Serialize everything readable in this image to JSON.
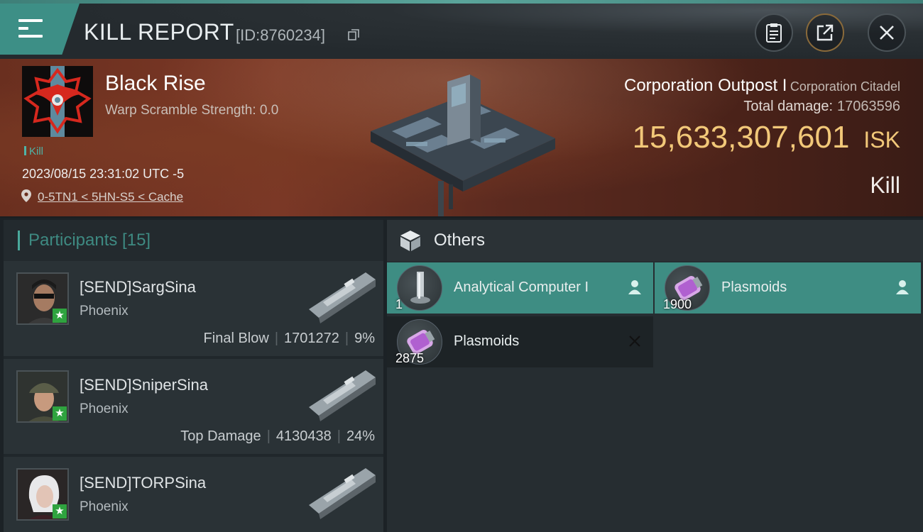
{
  "header": {
    "title": "KILL REPORT",
    "report_id": "[ID:8760234]",
    "icons": [
      "menu-icon",
      "copy-icon",
      "clipboard-icon",
      "share-icon",
      "close-icon"
    ]
  },
  "victim": {
    "name": "Black Rise",
    "warp_scramble": "Warp Scramble Strength: 0.0",
    "kill_tag": "Kill",
    "timestamp": "2023/08/15 23:31:02 UTC -5",
    "location": "0-5TN1 < 5HN-S5 < Cache"
  },
  "ship": {
    "name": "Corporation Outpost I",
    "class": "Corporation Citadel",
    "total_damage_label": "Total damage:",
    "total_damage": "17063596",
    "isk_value": "15,633,307,601",
    "isk_unit": "ISK",
    "result": "Kill"
  },
  "participants": {
    "title": "Participants [15]",
    "rows": [
      {
        "name": "[SEND]SargSina",
        "ship": "Phoenix",
        "role": "Final Blow",
        "damage": "1701272",
        "percent": "9%"
      },
      {
        "name": "[SEND]SniperSina",
        "ship": "Phoenix",
        "role": "Top Damage",
        "damage": "4130438",
        "percent": "24%"
      },
      {
        "name": "[SEND]TORPSina",
        "ship": "Phoenix",
        "role": "",
        "damage": "",
        "percent": ""
      }
    ]
  },
  "others": {
    "title": "Others",
    "items": [
      {
        "name": "Analytical Computer I",
        "qty": "1",
        "status": "destroyed"
      },
      {
        "name": "Plasmoids",
        "qty": "1900",
        "status": "destroyed"
      },
      {
        "name": "Plasmoids",
        "qty": "2875",
        "status": "dropped"
      }
    ]
  },
  "colors": {
    "accent": "#3e8d83",
    "isk": "#f2c879",
    "star_badge": "#2fa33f"
  }
}
